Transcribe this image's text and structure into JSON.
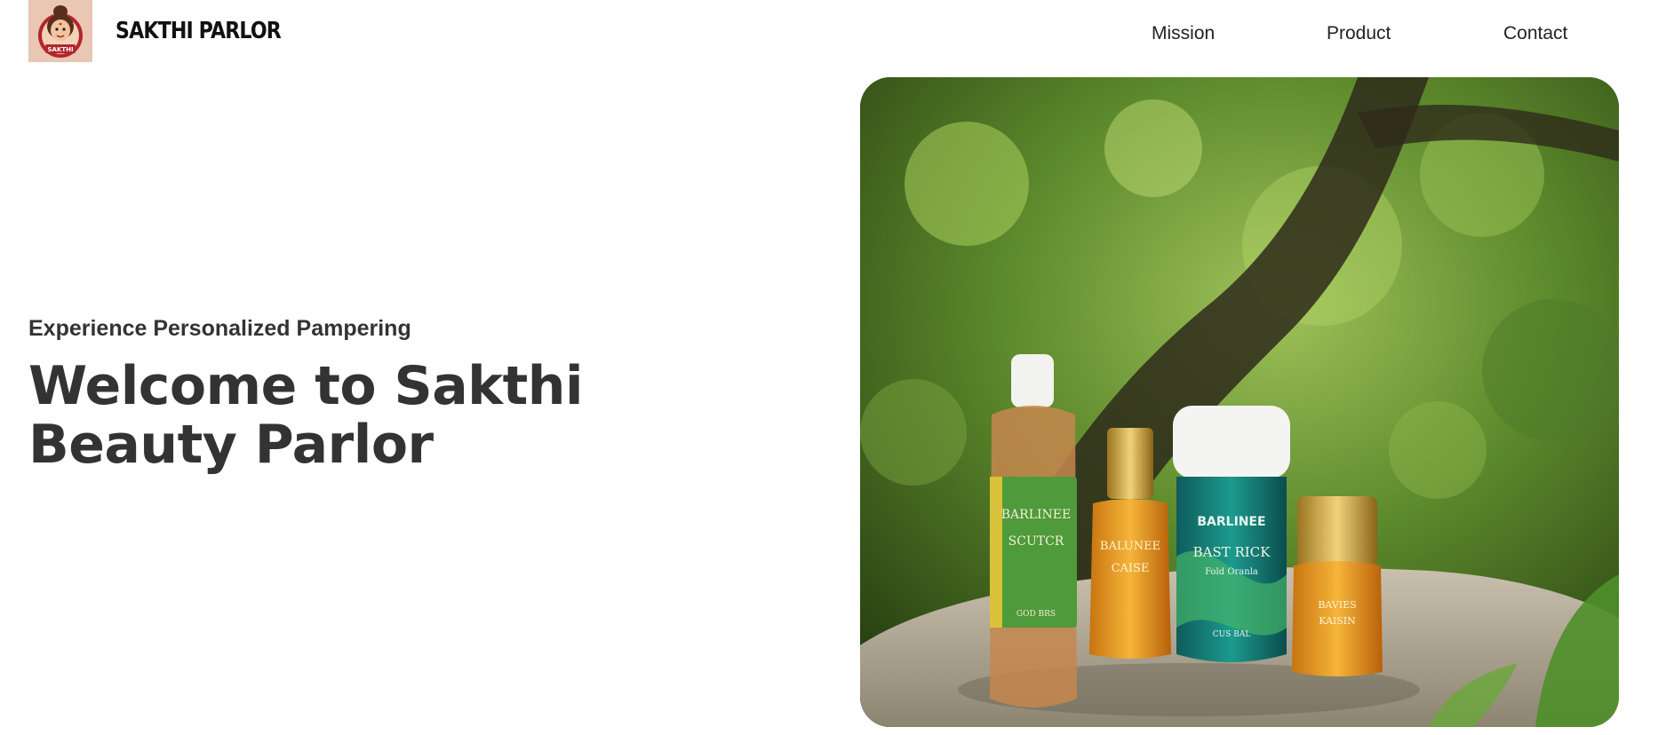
{
  "header": {
    "brand": "SAKTHI PARLOR",
    "logo_text": "SAKTHI",
    "nav": [
      {
        "label": "Mission"
      },
      {
        "label": "Product"
      },
      {
        "label": "Contact"
      }
    ]
  },
  "hero": {
    "tagline": "Experience Personalized Pampering",
    "headline": "Welcome to Sakthi Beauty Parlor",
    "image": {
      "icon": "product-photo",
      "bottles": [
        {
          "brand": "BARLINEE",
          "name": "SCUTCR",
          "footer": "GOD BRS"
        },
        {
          "brand": "BALUNEE",
          "name": "CAISE"
        },
        {
          "brand": "BARLINEE",
          "name": "BAST RICK",
          "sub": "Fold Oranla",
          "footer": "CUS BAL"
        },
        {
          "brand": "BAVIES",
          "name": "KAISIN"
        }
      ]
    }
  },
  "colors": {
    "text": "#333333",
    "brand_text": "#111111",
    "background": "#ffffff",
    "logo_bg": "#e9c7b4",
    "logo_accent": "#b3262c"
  }
}
